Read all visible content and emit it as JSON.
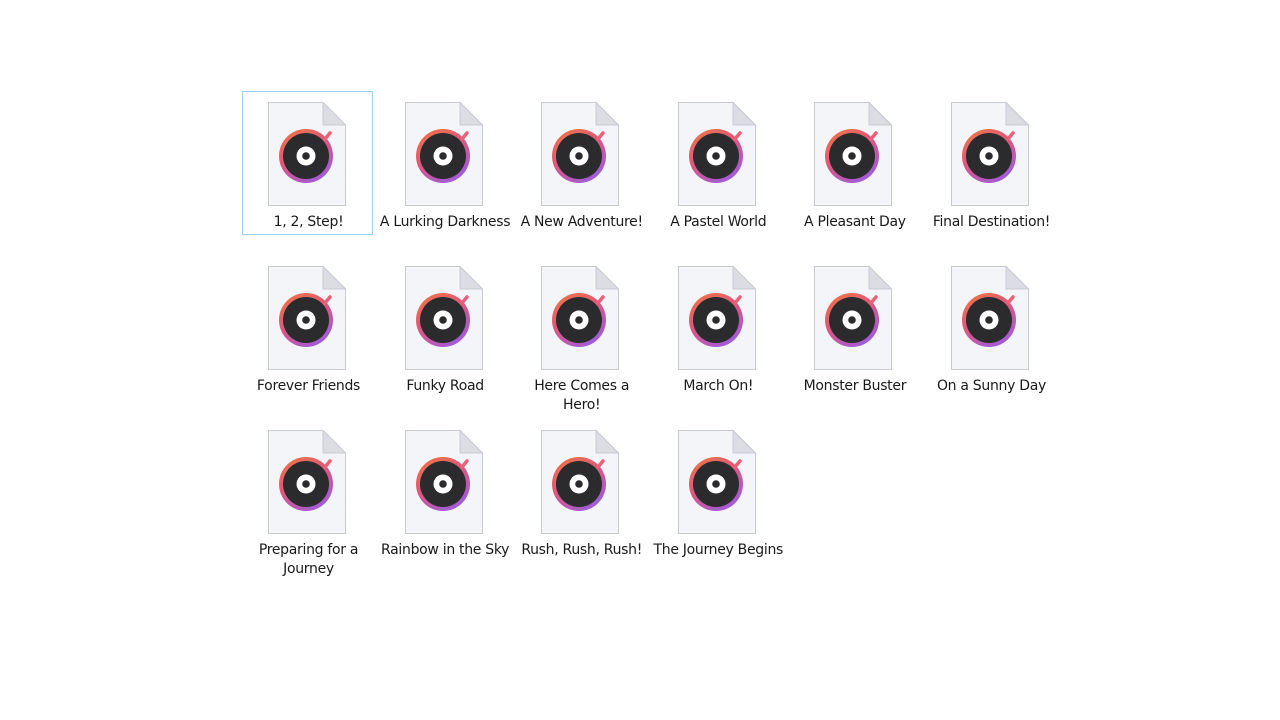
{
  "window": {
    "view": "large-icons"
  },
  "file_icon": {
    "name": "music-disc-file-icon",
    "colors": {
      "page": "#f4f5f9",
      "page_border": "#c9cbd3",
      "fold": "#dcdde3",
      "ring_gradient": [
        "#f07a3c",
        "#e0577a",
        "#a35bd6"
      ],
      "disc": "#2b2b2e",
      "disc_center": "#ffffff",
      "needle": "#e8607a"
    }
  },
  "files": [
    {
      "name": "1, 2, Step!",
      "selected": true
    },
    {
      "name": "A Lurking Darkness",
      "selected": false
    },
    {
      "name": "A New Adventure!",
      "selected": false
    },
    {
      "name": "A Pastel World",
      "selected": false
    },
    {
      "name": "A Pleasant Day",
      "selected": false
    },
    {
      "name": "Final Destination!",
      "selected": false
    },
    {
      "name": "Forever Friends",
      "selected": false
    },
    {
      "name": "Funky Road",
      "selected": false
    },
    {
      "name": "Here Comes a Hero!",
      "selected": false
    },
    {
      "name": "March On!",
      "selected": false
    },
    {
      "name": "Monster Buster",
      "selected": false
    },
    {
      "name": "On a Sunny Day",
      "selected": false
    },
    {
      "name": "Preparing for a Journey",
      "selected": false
    },
    {
      "name": "Rainbow in the Sky",
      "selected": false
    },
    {
      "name": "Rush, Rush, Rush!",
      "selected": false
    },
    {
      "name": "The Journey Begins",
      "selected": false
    }
  ]
}
